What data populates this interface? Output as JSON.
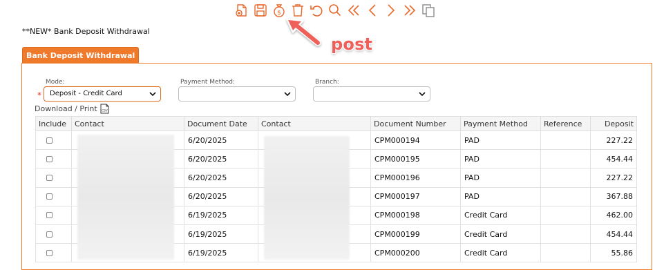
{
  "toolbar": {
    "buttons": [
      {
        "icon": "new-document-icon"
      },
      {
        "icon": "save-icon"
      },
      {
        "icon": "post-money-bag-icon"
      },
      {
        "icon": "delete-icon"
      },
      {
        "icon": "undo-icon"
      },
      {
        "icon": "search-icon"
      },
      {
        "icon": "first-page-icon"
      },
      {
        "icon": "previous-icon"
      },
      {
        "icon": "next-icon"
      },
      {
        "icon": "last-page-icon"
      },
      {
        "icon": "copy-icon"
      }
    ],
    "accent": "#e8692a"
  },
  "page_title": "**NEW* Bank Deposit Withdrawal",
  "annotation": {
    "label": "post",
    "color": "#f0605a"
  },
  "tab": {
    "label": "Bank Deposit Withdrawal",
    "color": "#f07a2c"
  },
  "filters": {
    "mode": {
      "label": "Mode:",
      "value": "Deposit - Credit Card",
      "required": true
    },
    "payment_method": {
      "label": "Payment Method:",
      "value": ""
    },
    "branch": {
      "label": "Branch:",
      "value": ""
    }
  },
  "download_label": "Download / Print",
  "table": {
    "columns": [
      "Include",
      "Contact",
      "Document Date",
      "Contact",
      "Document Number",
      "Payment Method",
      "Reference",
      "Deposit"
    ],
    "rows": [
      {
        "date": "6/20/2025",
        "doc": "CPM000194",
        "method": "PAD",
        "reference": "",
        "deposit": "227.22"
      },
      {
        "date": "6/20/2025",
        "doc": "CPM000195",
        "method": "PAD",
        "reference": "",
        "deposit": "454.44"
      },
      {
        "date": "6/20/2025",
        "doc": "CPM000196",
        "method": "PAD",
        "reference": "",
        "deposit": "227.22"
      },
      {
        "date": "6/20/2025",
        "doc": "CPM000197",
        "method": "PAD",
        "reference": "",
        "deposit": "367.88"
      },
      {
        "date": "6/19/2025",
        "doc": "CPM000198",
        "method": "Credit Card",
        "reference": "",
        "deposit": "462.00"
      },
      {
        "date": "6/19/2025",
        "doc": "CPM000199",
        "method": "Credit Card",
        "reference": "",
        "deposit": "454.44"
      },
      {
        "date": "6/19/2025",
        "doc": "CPM000200",
        "method": "Credit Card",
        "reference": "",
        "deposit": "55.86"
      }
    ]
  }
}
